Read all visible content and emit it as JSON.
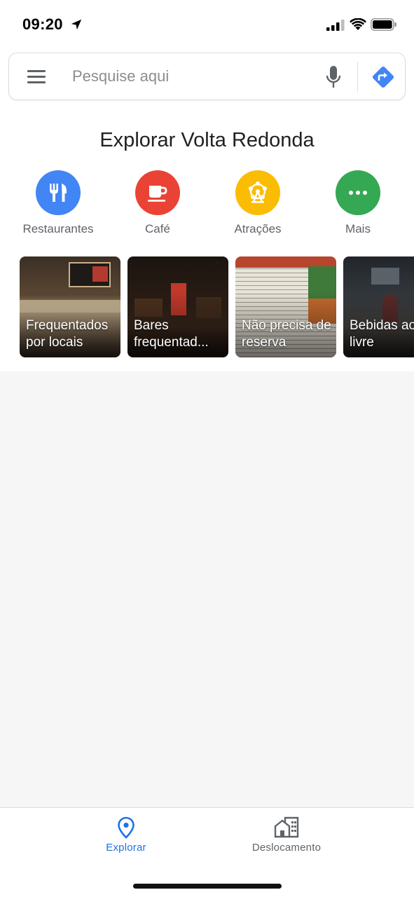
{
  "status_bar": {
    "time": "09:20",
    "icons": [
      "location-arrow-icon",
      "signal-icon",
      "wifi-icon",
      "battery-icon"
    ]
  },
  "search": {
    "placeholder": "Pesquise aqui",
    "value": "",
    "icons": [
      "menu-icon",
      "mic-icon",
      "directions-icon"
    ]
  },
  "explore": {
    "title": "Explorar Volta Redonda",
    "categories": [
      {
        "label": "Restaurantes",
        "icon": "fork-knife-icon",
        "color": "#4285f4"
      },
      {
        "label": "Café",
        "icon": "coffee-cup-icon",
        "color": "#ea4335"
      },
      {
        "label": "Atrações",
        "icon": "ferris-wheel-icon",
        "color": "#fbbc04"
      },
      {
        "label": "Mais",
        "icon": "more-dots-icon",
        "color": "#34a853"
      }
    ],
    "cards": [
      {
        "label": "Frequentados por locais"
      },
      {
        "label": "Bares frequentad..."
      },
      {
        "label": "Não precisa de reserva"
      },
      {
        "label": "Bebidas ao ar livre"
      }
    ]
  },
  "bottom_nav": {
    "items": [
      {
        "label": "Explorar",
        "icon": "location-pin-icon",
        "active": true
      },
      {
        "label": "Deslocamento",
        "icon": "commute-buildings-icon",
        "active": false
      }
    ]
  },
  "colors": {
    "accent": "#4285f4",
    "active_nav": "#1a73e8",
    "inactive_nav": "#5f6368"
  }
}
